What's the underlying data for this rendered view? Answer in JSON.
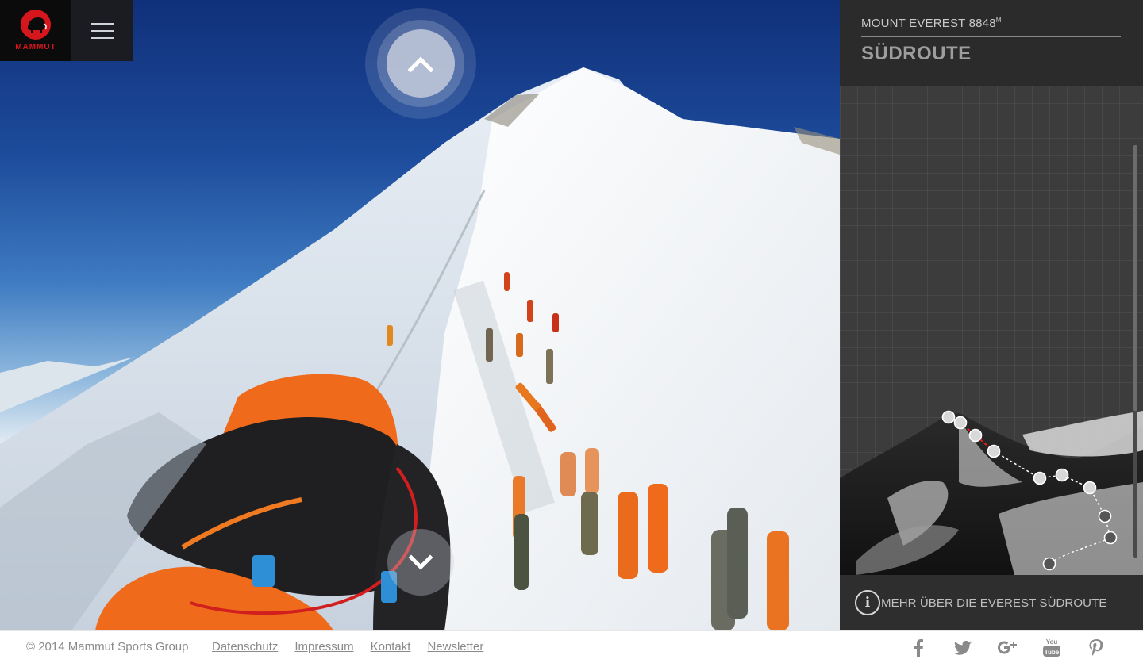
{
  "brand": {
    "name": "MAMMUT",
    "color": "#d5161c"
  },
  "header": {
    "menu_icon": "hamburger-menu-icon"
  },
  "navigation": {
    "up_icon": "chevron-up-icon",
    "down_icon": "chevron-down-icon"
  },
  "panel": {
    "subtitle": "MOUNT EVEREST 8848",
    "subtitle_sup": "M",
    "title": "SÜDROUTE",
    "info_icon": "info-icon",
    "more_link": "MEHR ÜBER DIE EVEREST SÜDROUTE",
    "route_waypoints": 11
  },
  "footer": {
    "copyright": "© 2014 Mammut Sports Group",
    "links": [
      "Datenschutz",
      "Impressum",
      "Kontakt",
      "Newsletter"
    ],
    "social": [
      "facebook-icon",
      "twitter-icon",
      "google-plus-icon",
      "youtube-icon",
      "pinterest-icon"
    ]
  },
  "colors": {
    "panel_bg": "#3a3a3a",
    "panel_head_bg": "#2b2b2b",
    "footer_text": "#8a8a8a"
  }
}
